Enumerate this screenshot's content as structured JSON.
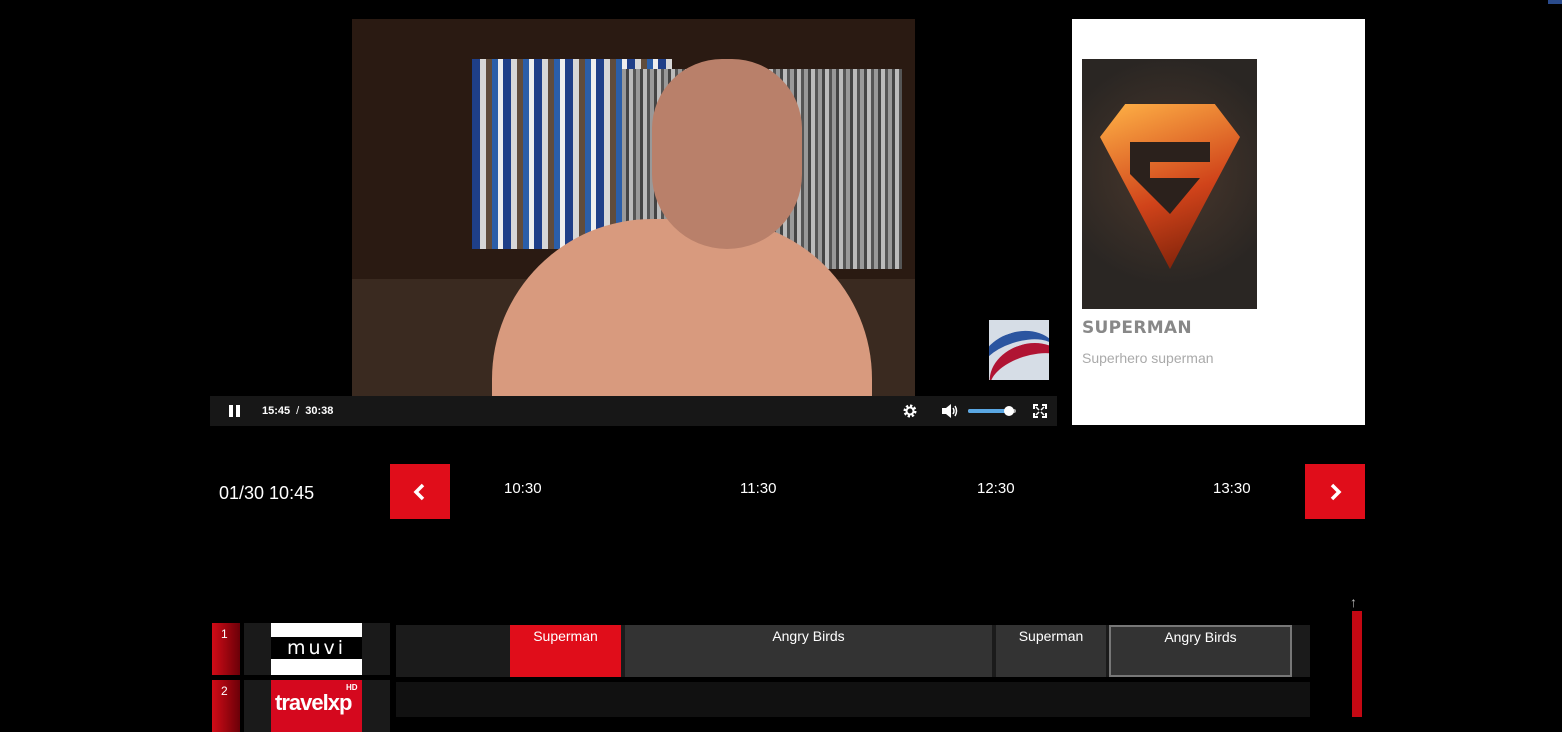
{
  "player": {
    "current_time": "15:45",
    "separator": "/",
    "duration": "30:38",
    "progress": 0.514,
    "volume": 0.85,
    "icons": {
      "pause": "pause-icon",
      "settings": "gear-icon",
      "volume": "speaker-icon",
      "fullscreen": "fullscreen-icon"
    }
  },
  "info": {
    "title": "SUPERMAN",
    "description": "Superhero superman"
  },
  "timeline": {
    "current": "01/30 10:45",
    "slots": [
      "10:30",
      "11:30",
      "12:30",
      "13:30"
    ]
  },
  "channels": [
    {
      "number": "1",
      "logo": "muvi",
      "logo_text": "muvi",
      "programs": [
        {
          "title": "Superman"
        },
        {
          "title": "Angry Birds"
        },
        {
          "title": "Superman"
        },
        {
          "title": "Angry Birds"
        }
      ]
    },
    {
      "number": "2",
      "logo": "travelxp HD",
      "logo_text": "travelxp",
      "logo_badge": "HD",
      "programs": []
    }
  ],
  "colors": {
    "accent": "#e00d1a",
    "background": "#000000",
    "program_active": "#e00d1a",
    "program_default": "#333333"
  }
}
